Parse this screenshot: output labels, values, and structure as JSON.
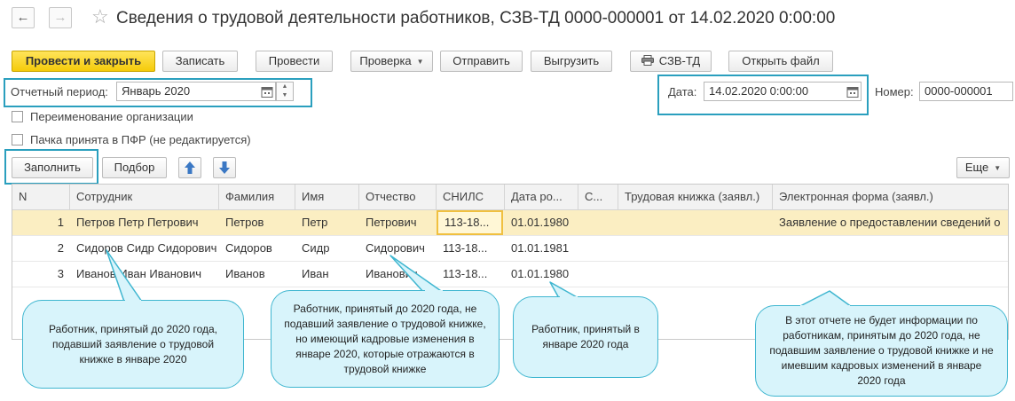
{
  "window": {
    "title": "Сведения о трудовой деятельности работников, СЗВ-ТД 0000-000001 от 14.02.2020 0:00:00"
  },
  "toolbar": {
    "post_close": "Провести и закрыть",
    "save": "Записать",
    "post": "Провести",
    "check": "Проверка",
    "send": "Отправить",
    "upload": "Выгрузить",
    "print_szv": "СЗВ-ТД",
    "open_file": "Открыть файл"
  },
  "form": {
    "period_label": "Отчетный период:",
    "period_value": "Январь 2020",
    "date_label": "Дата:",
    "date_value": "14.02.2020  0:00:00",
    "number_label": "Номер:",
    "number_value": "0000-000001",
    "rename_org": "Переименование организации",
    "accepted_pfr": "Пачка принята в ПФР (не редактируется)"
  },
  "table_toolbar": {
    "fill": "Заполнить",
    "select": "Подбор",
    "more": "Еще"
  },
  "table": {
    "columns": [
      "N",
      "Сотрудник",
      "Фамилия",
      "Имя",
      "Отчество",
      "СНИЛС",
      "Дата ро...",
      "С...",
      "Трудовая книжка (заявл.)",
      "Электронная форма (заявл.)"
    ],
    "rows": [
      {
        "n": "1",
        "employee": "Петров Петр Петрович",
        "last": "Петров",
        "first": "Петр",
        "middle": "Петрович",
        "snils": "113-18...",
        "birth": "01.01.1980",
        "s": "",
        "book": "",
        "eform": "Заявление о предоставлении сведений о"
      },
      {
        "n": "2",
        "employee": "Сидоров Сидр Сидорович",
        "last": "Сидоров",
        "first": "Сидр",
        "middle": "Сидорович",
        "snils": "113-18...",
        "birth": "01.01.1981",
        "s": "",
        "book": "",
        "eform": ""
      },
      {
        "n": "3",
        "employee": "Иванов Иван Иванович",
        "last": "Иванов",
        "first": "Иван",
        "middle": "Иванович",
        "snils": "113-18...",
        "birth": "01.01.1980",
        "s": "",
        "book": "",
        "eform": ""
      }
    ]
  },
  "callouts": {
    "c1": "Работник, принятый до 2020 года, подавший заявление о трудовой книжке в январе 2020",
    "c2": "Работник, принятый до 2020 года, не подавший заявление о трудовой книжке, но имеющий кадровые изменения в январе 2020, которые отражаются в трудовой книжке",
    "c3": "Работник, принятый в январе 2020 года",
    "c4": "В этот отчете не будет информации по работникам, принятым до 2020 года, не подавшим заявление о трудовой книжке и не имевшим кадровых изменений в январе 2020 года"
  },
  "colors": {
    "accent_frame": "#2a9fbe",
    "primary_button": "#f5cb0a",
    "selected_row": "#fbeec2",
    "callout_fill": "#d8f4fb",
    "arrow_blue": "#3b78c4"
  }
}
